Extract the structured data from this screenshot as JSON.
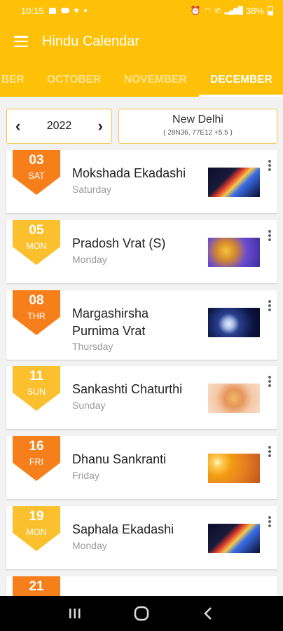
{
  "status_bar": {
    "time": "10:15",
    "battery": "38%"
  },
  "app_bar": {
    "title": "Hindu Calendar"
  },
  "month_tabs": [
    {
      "label": "BER",
      "active": false
    },
    {
      "label": "OCTOBER",
      "active": false
    },
    {
      "label": "NOVEMBER",
      "active": false
    },
    {
      "label": "DECEMBER",
      "active": true
    }
  ],
  "year_selector": {
    "year": "2022"
  },
  "location": {
    "city": "New Delhi",
    "coords": "( 28N36, 77E12 +5.5 )"
  },
  "events": [
    {
      "date": "03",
      "day_short": "SAT",
      "title": "Mokshada Ekadashi",
      "day": "Saturday",
      "badge_color": "#f77f1b"
    },
    {
      "date": "05",
      "day_short": "MON",
      "title": "Pradosh Vrat (S)",
      "day": "Monday",
      "badge_color": "#fbc02d"
    },
    {
      "date": "08",
      "day_short": "THR",
      "title": "Margashirsha Purnima Vrat",
      "day": "Thursday",
      "badge_color": "#f77f1b"
    },
    {
      "date": "11",
      "day_short": "SUN",
      "title": "Sankashti Chaturthi",
      "day": "Sunday",
      "badge_color": "#fbc02d"
    },
    {
      "date": "16",
      "day_short": "FRI",
      "title": "Dhanu Sankranti",
      "day": "Friday",
      "badge_color": "#f77f1b"
    },
    {
      "date": "19",
      "day_short": "MON",
      "title": "Saphala Ekadashi",
      "day": "Monday",
      "badge_color": "#fbc02d"
    },
    {
      "date": "21",
      "day_short": "",
      "title": "",
      "day": "",
      "badge_color": "#f77f1b"
    }
  ],
  "colors": {
    "primary": "#ffc107",
    "badge_orange": "#f77f1b",
    "badge_yellow": "#fbc02d",
    "card_border": "#f6c342"
  },
  "icons": {
    "menu": "hamburger-icon",
    "prev": "chevron-left-icon",
    "next": "chevron-right-icon",
    "more": "more-vert-icon",
    "recents": "recents-icon",
    "home": "home-icon",
    "back": "back-icon"
  }
}
